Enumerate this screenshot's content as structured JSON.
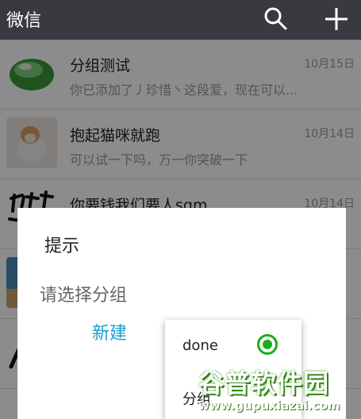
{
  "app": {
    "title": "微信",
    "search_icon": "search-icon",
    "add_icon": "plus-icon"
  },
  "chats": [
    {
      "name": "分组测试",
      "time": "10月15日",
      "preview": "你已添加了丿珍惜丶这段爱，现在可以..."
    },
    {
      "name": "抱起猫咪就跑",
      "time": "10月14日",
      "preview": "可以试一下吗，万一你突破一下"
    },
    {
      "name": "你要钱我们要人sqm",
      "time": "10月14日",
      "preview": ""
    }
  ],
  "dialog": {
    "title": "提示",
    "message": "请选择分组",
    "new_button": "新建"
  },
  "group_popup": {
    "options": [
      {
        "label": "done",
        "selected": true
      },
      {
        "label": "分组",
        "selected": false
      }
    ]
  },
  "watermark": {
    "brand": "谷普软件园",
    "url": "www.gupuxiazai.com"
  },
  "colors": {
    "topbar": "#393a3f",
    "accent_blue": "#1c9bd0",
    "radio_green": "#1aad19"
  }
}
